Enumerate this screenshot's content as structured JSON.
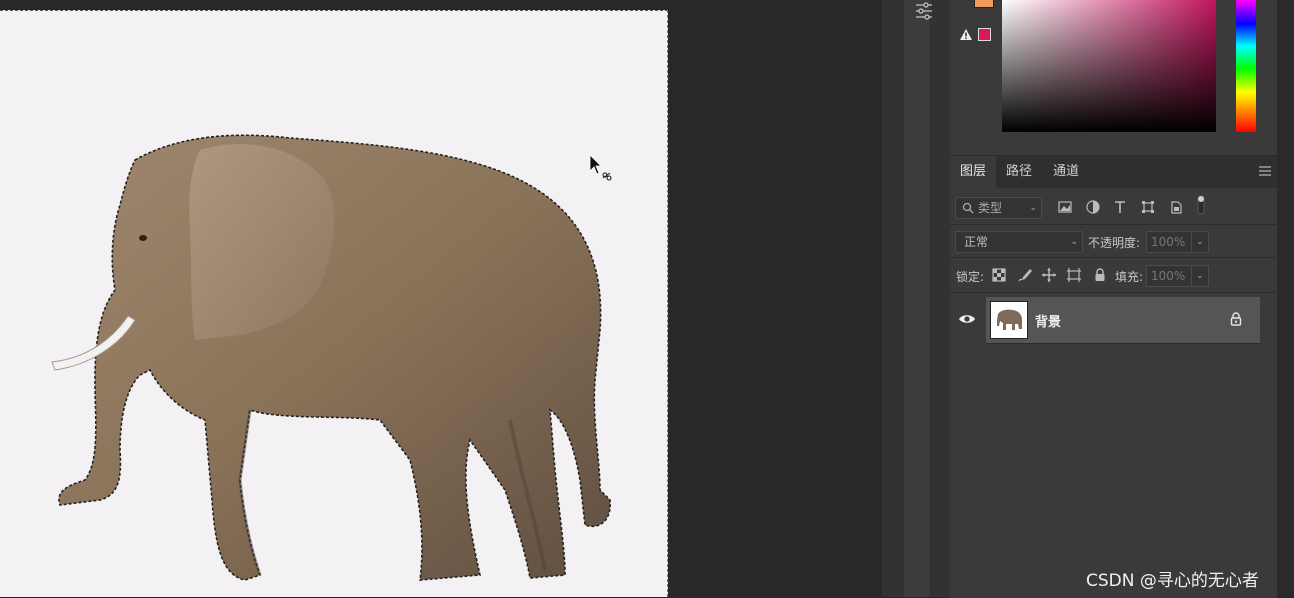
{
  "layers_panel": {
    "tabs": [
      "图层",
      "路径",
      "通道"
    ],
    "filter_placeholder": "类型",
    "blend_mode": "正常",
    "opacity_label": "不透明度:",
    "opacity_value": "100%",
    "lock_label": "锁定:",
    "fill_label": "填充:",
    "fill_value": "100%",
    "layers": [
      {
        "name": "背景",
        "visible": true,
        "locked": true
      }
    ]
  },
  "color_picker": {
    "foreground": "#f39a5e",
    "gamut_warning": "#e0145a",
    "hue": "#c0165c"
  },
  "watermark": "CSDN @寻心的无心者"
}
